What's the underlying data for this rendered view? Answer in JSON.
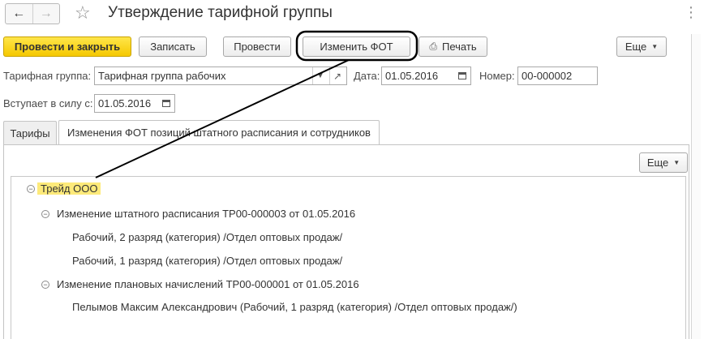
{
  "window": {
    "title": "Утверждение тарифной группы",
    "nav_back_icon": "arrow-left-icon",
    "nav_forward_icon": "arrow-right-icon",
    "favorite_icon": "star-icon",
    "window_controls": "⋮"
  },
  "toolbar": {
    "post_and_close": "Провести и закрыть",
    "save": "Записать",
    "post": "Провести",
    "change_payroll": "Изменить ФОТ",
    "print": "Печать",
    "more": "Еще",
    "primary_color": "#f5c800"
  },
  "form": {
    "tariff_group_label": "Тарифная группа:",
    "tariff_group_value": "Тарифная группа рабочих",
    "date_label": "Дата:",
    "date_value": "01.05.2016",
    "number_label": "Номер:",
    "number_value": "00-000002",
    "effective_label": "Вступает в силу с:",
    "effective_value": "01.05.2016"
  },
  "tabs": [
    {
      "label": "Тарифы",
      "active": false
    },
    {
      "label": "Изменения ФОТ позиций штатного расписания и сотрудников",
      "active": true
    }
  ],
  "panel": {
    "more": "Еще"
  },
  "tree": [
    {
      "level": 0,
      "text": "Трейд ООО",
      "expanded": true,
      "highlighted": true
    },
    {
      "level": 1,
      "text": "Изменение штатного расписания ТР00-000003 от 01.05.2016",
      "expanded": true
    },
    {
      "level": 2,
      "text": "Рабочий, 2 разряд (категория) /Отдел оптовых продаж/"
    },
    {
      "level": 2,
      "text": "Рабочий, 1 разряд (категория) /Отдел оптовых продаж/"
    },
    {
      "level": 1,
      "text": "Изменение плановых начислений ТР00-000001 от 01.05.2016",
      "expanded": true
    },
    {
      "level": 2,
      "text": "Пелымов Максим Александрович (Рабочий, 1 разряд (категория) /Отдел оптовых продаж/)"
    }
  ],
  "highlight_color": "#fdea7a"
}
